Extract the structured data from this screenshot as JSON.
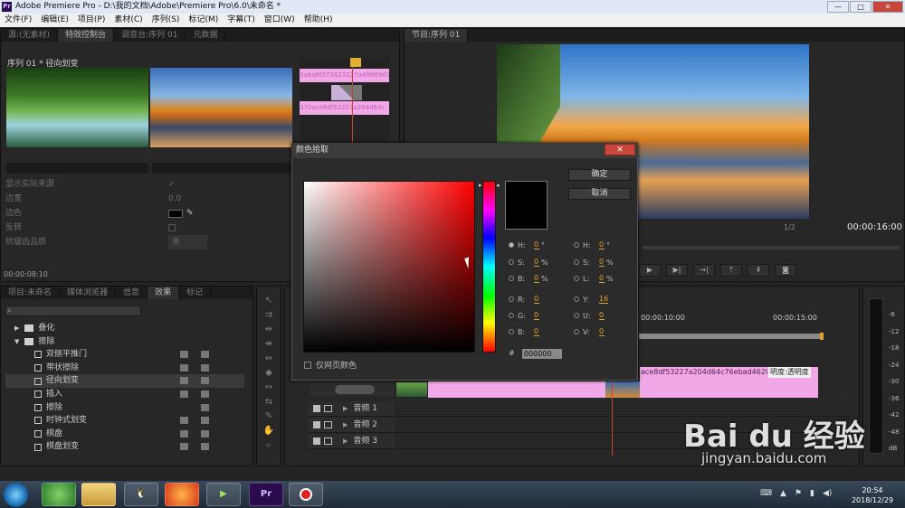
{
  "window": {
    "title": "Adobe Premiere Pro - D:\\我的文档\\Adobe\\Premiere Pro\\6.0\\未命名 *",
    "minimize": "—",
    "maximize": "□",
    "close": "✕"
  },
  "menu": [
    "文件(F)",
    "编辑(E)",
    "项目(P)",
    "素材(C)",
    "序列(S)",
    "标记(M)",
    "字幕(T)",
    "窗口(W)",
    "帮助(H)"
  ],
  "source_panel": {
    "tabs": [
      "源:(无素材)",
      "特效控制台",
      "调音台:序列 01",
      "元数据"
    ],
    "sequence_label": "序列 01 * 径向划变",
    "clip_a_name": "3a6a8f273823227a4f8f6962",
    "clip_b_name": "370ace8df53227a204d64c",
    "rows": [
      {
        "label": "显示实际来源",
        "value": "✓"
      },
      {
        "label": "边宽",
        "value": "0.0"
      },
      {
        "label": "边色",
        "value": ""
      },
      {
        "label": "反转",
        "value": ""
      },
      {
        "label": "抗锯齿品质",
        "value": "关"
      }
    ],
    "timecode": "00:00:08:10"
  },
  "program_panel": {
    "tab": "节目:序列 01",
    "zoom": "1/2",
    "timecode": "00:00:16:00"
  },
  "effects_panel": {
    "tabs": [
      "项目:未命名",
      "媒体浏览器",
      "信息",
      "效果",
      "标记"
    ],
    "items": [
      {
        "label": "叠化",
        "type": "folder",
        "indent": 0,
        "expanded": false
      },
      {
        "label": "擦除",
        "type": "folder",
        "indent": 0,
        "expanded": true
      },
      {
        "label": "双侧平推门",
        "type": "effect",
        "indent": 1
      },
      {
        "label": "带状擦除",
        "type": "effect",
        "indent": 1
      },
      {
        "label": "径向划变",
        "type": "effect",
        "indent": 1,
        "selected": true
      },
      {
        "label": "插入",
        "type": "effect",
        "indent": 1
      },
      {
        "label": "擦除",
        "type": "effect",
        "indent": 1
      },
      {
        "label": "时钟式划变",
        "type": "effect",
        "indent": 1
      },
      {
        "label": "棋盘",
        "type": "effect",
        "indent": 1
      },
      {
        "label": "棋盘划变",
        "type": "effect",
        "indent": 1
      }
    ]
  },
  "timeline": {
    "ruler": [
      "00:00:10:00",
      "00:00:15:00"
    ],
    "video_clip_label": "ace8df53227a204d64c76ebad4620.jpg",
    "video_clip_mode": "明度:透明度",
    "audio_tracks": [
      "音频 1",
      "音频 2",
      "音频 3"
    ]
  },
  "meters": {
    "labels": [
      "-6",
      "-12",
      "-18",
      "-24",
      "-30",
      "-36",
      "-42",
      "-48",
      "dB"
    ]
  },
  "color_picker": {
    "title": "颜色拾取",
    "ok": "确定",
    "cancel": "取消",
    "left_fields": [
      {
        "label": "H:",
        "value": "0",
        "unit": "°",
        "selected": true
      },
      {
        "label": "S:",
        "value": "0",
        "unit": "%"
      },
      {
        "label": "B:",
        "value": "0",
        "unit": "%"
      },
      {
        "label": "R:",
        "value": "0",
        "unit": ""
      },
      {
        "label": "G:",
        "value": "0",
        "unit": ""
      },
      {
        "label": "B:",
        "value": "0",
        "unit": ""
      }
    ],
    "right_fields": [
      {
        "label": "H:",
        "value": "0",
        "unit": "°"
      },
      {
        "label": "S:",
        "value": "0",
        "unit": "%"
      },
      {
        "label": "L:",
        "value": "0",
        "unit": "%"
      },
      {
        "label": "Y:",
        "value": "16",
        "unit": ""
      },
      {
        "label": "U:",
        "value": "0",
        "unit": ""
      },
      {
        "label": "V:",
        "value": "0",
        "unit": ""
      }
    ],
    "hex_label": "#",
    "hex_value": "000000",
    "web_only_label": "仅网页颜色",
    "current_color": "#000000"
  },
  "taskbar": {
    "time": "20:54",
    "date": "2018/12/29",
    "pr_label": "Pr"
  },
  "watermark": {
    "brand": "Bai du 经验",
    "url": "jingyan.baidu.com"
  }
}
